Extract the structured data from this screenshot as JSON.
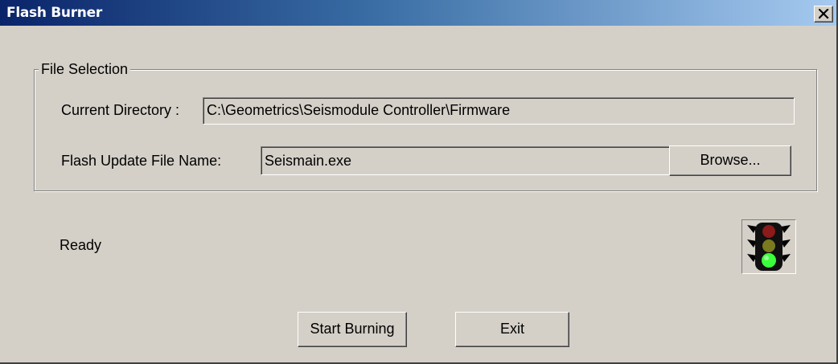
{
  "window": {
    "title": "Flash Burner"
  },
  "file_selection": {
    "legend": "File Selection",
    "current_directory_label": "Current Directory :",
    "current_directory_value": "C:\\Geometrics\\Seismodule Controller\\Firmware",
    "flash_file_label": "Flash Update File Name:",
    "flash_file_value": "Seismain.exe",
    "browse_label": "Browse..."
  },
  "status": {
    "text": "Ready",
    "indicator_icon": "traffic-light-icon",
    "active_light": "green"
  },
  "actions": {
    "start_label": "Start Burning",
    "exit_label": "Exit"
  },
  "colors": {
    "titlebar_start": "#0a246a",
    "titlebar_end": "#a6caf0",
    "dialog_face": "#d4d0c8",
    "light_red": "#8b1a1a",
    "light_yellow": "#7a7a1e",
    "light_green": "#3cff3c"
  }
}
